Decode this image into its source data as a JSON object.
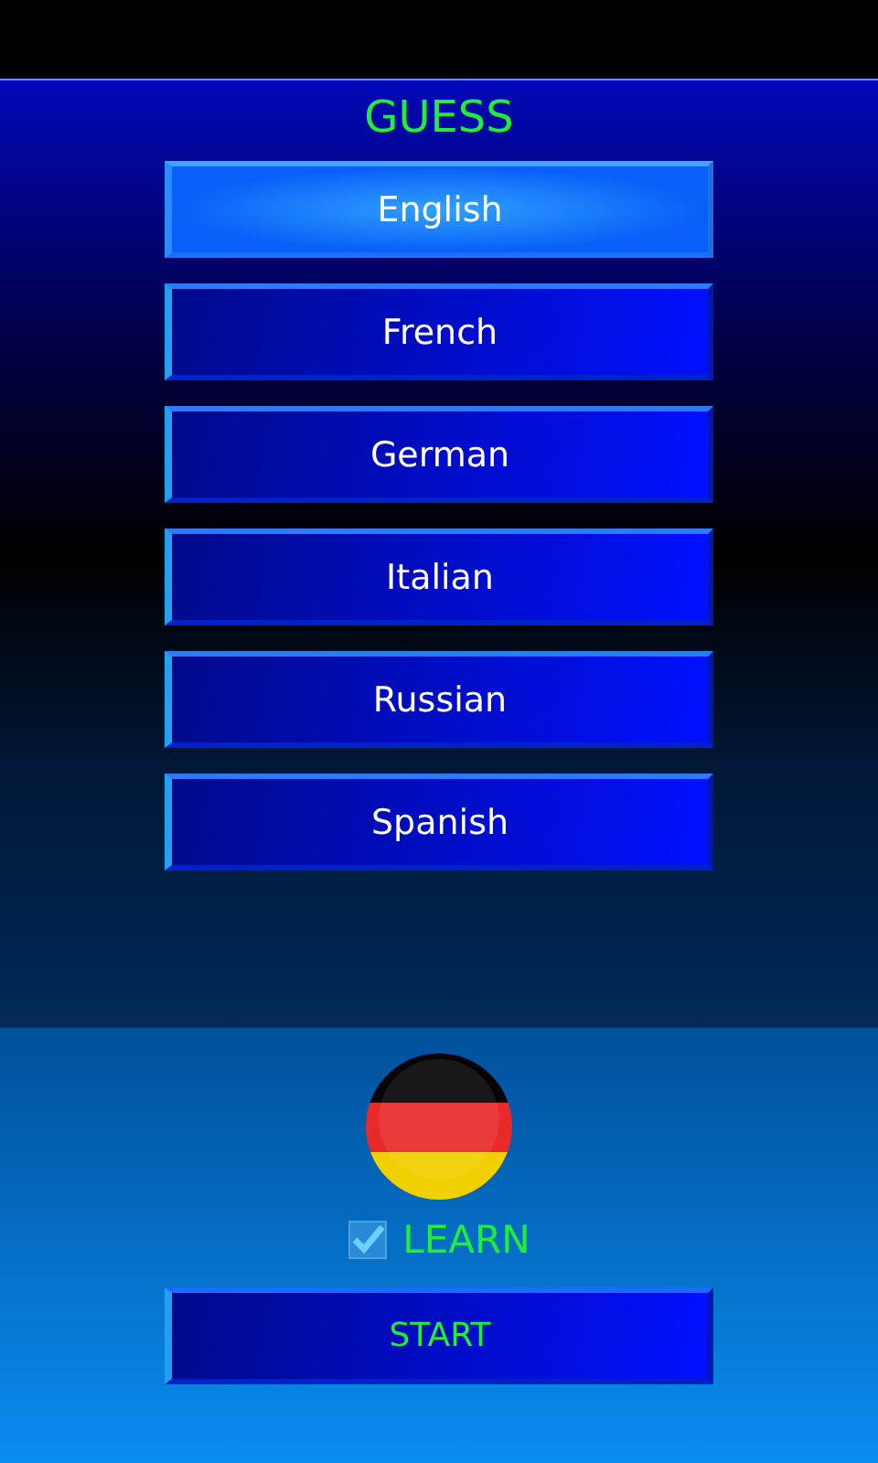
{
  "title": "GUESS",
  "languages": [
    {
      "label": "English",
      "selected": true
    },
    {
      "label": "French",
      "selected": false
    },
    {
      "label": "German",
      "selected": false
    },
    {
      "label": "Italian",
      "selected": false
    },
    {
      "label": "Russian",
      "selected": false
    },
    {
      "label": "Spanish",
      "selected": false
    }
  ],
  "learn": {
    "label": "LEARN",
    "checked": true
  },
  "start_button": "START"
}
